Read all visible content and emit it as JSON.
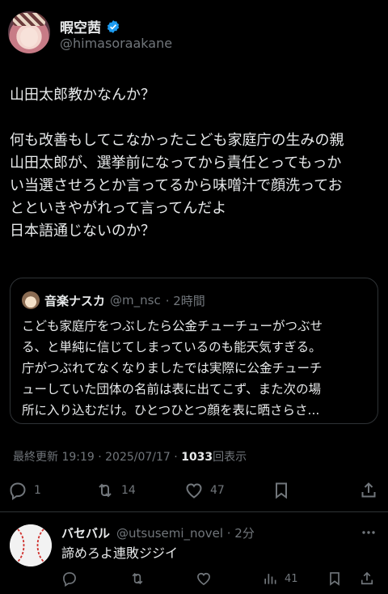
{
  "author": {
    "display_name": "暇空茜",
    "handle": "@himasoraakane",
    "verified_icon": "verified-badge-icon"
  },
  "tweet": {
    "lines": [
      "山田太郎教かなんか？",
      "",
      "何も改善もしてこなかったこども家庭庁の生みの親",
      "山田太郎が、選挙前になってから責任とってもっか",
      "い当選させろとか言ってるから味噌汁で顔洗ってお",
      "とといきやがれって言ってんだよ",
      "日本語通じないのか？"
    ]
  },
  "quote": {
    "name": "音楽ナスカ",
    "handle": "@m_nsc",
    "time": "· 2時間",
    "lines": [
      "こども家庭庁をつぶしたら公金チューチューがつぶせ",
      "る、と単純に信じてしまっているのも能天気すぎる。",
      "庁がつぶれてなくなりましたでは実際に公金チューチ",
      "ューしていた団体の名前は表に出てこず、また次の場",
      "所に入り込むだけ。ひとつひとつ顔を表に晒さらさ..."
    ]
  },
  "meta": {
    "updated": "最終更新 19:19 · 2025/07/17 ·",
    "views_count": "1033",
    "views_label": "回表示"
  },
  "actions": {
    "replies": "1",
    "retweets": "14",
    "likes": "47"
  },
  "reply": {
    "name": "バセバル",
    "handle": "@utsusemi_novel · 2分",
    "text": "諦めろよ連敗ジジイ",
    "views": "41"
  },
  "colors": {
    "background": "#000000",
    "text": "#e7e9ea",
    "muted": "#71767b",
    "border": "#2f3336",
    "verified": "#1d9bf0"
  }
}
